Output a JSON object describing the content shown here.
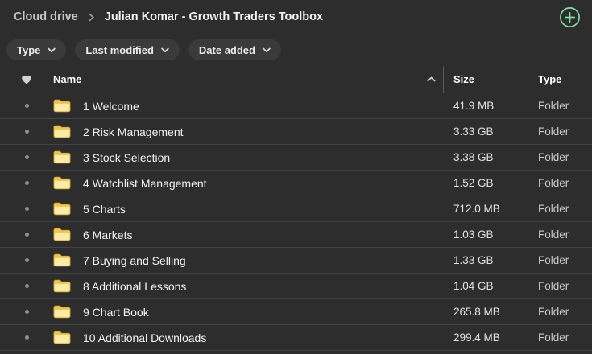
{
  "breadcrumb": {
    "root": "Cloud drive",
    "current": "Julian Komar - Growth Traders Toolbox"
  },
  "filters": [
    {
      "label": "Type"
    },
    {
      "label": "Last modified"
    },
    {
      "label": "Date added"
    }
  ],
  "table": {
    "headers": {
      "name": "Name",
      "size": "Size",
      "type": "Type"
    },
    "sort": {
      "column": "Name",
      "direction": "ascending"
    },
    "rows": [
      {
        "name": "1 Welcome",
        "size": "41.9 MB",
        "type": "Folder"
      },
      {
        "name": "2 Risk Management",
        "size": "3.33 GB",
        "type": "Folder"
      },
      {
        "name": "3 Stock Selection",
        "size": "3.38 GB",
        "type": "Folder"
      },
      {
        "name": "4 Watchlist Management",
        "size": "1.52 GB",
        "type": "Folder"
      },
      {
        "name": "5 Charts",
        "size": "712.0 MB",
        "type": "Folder"
      },
      {
        "name": "6 Markets",
        "size": "1.03 GB",
        "type": "Folder"
      },
      {
        "name": "7 Buying and Selling",
        "size": "1.33 GB",
        "type": "Folder"
      },
      {
        "name": "8 Additional Lessons",
        "size": "1.04 GB",
        "type": "Folder"
      },
      {
        "name": "9 Chart Book",
        "size": "265.8 MB",
        "type": "Folder"
      },
      {
        "name": "10 Additional Downloads",
        "size": "299.4 MB",
        "type": "Folder"
      }
    ]
  },
  "icons": {
    "add": "plus-circle",
    "breadcrumb_separator": "chevron-right",
    "filter_caret": "chevron-down",
    "favorite_column": "heart",
    "sort": "chevron-up",
    "item": "folder"
  },
  "colors": {
    "background": "#2d2d2d",
    "accent_green": "#7fe0a6",
    "folder_yellow": "#eec549",
    "folder_yellow_light": "#f8eca8",
    "pill_background": "#3a3a3a"
  }
}
